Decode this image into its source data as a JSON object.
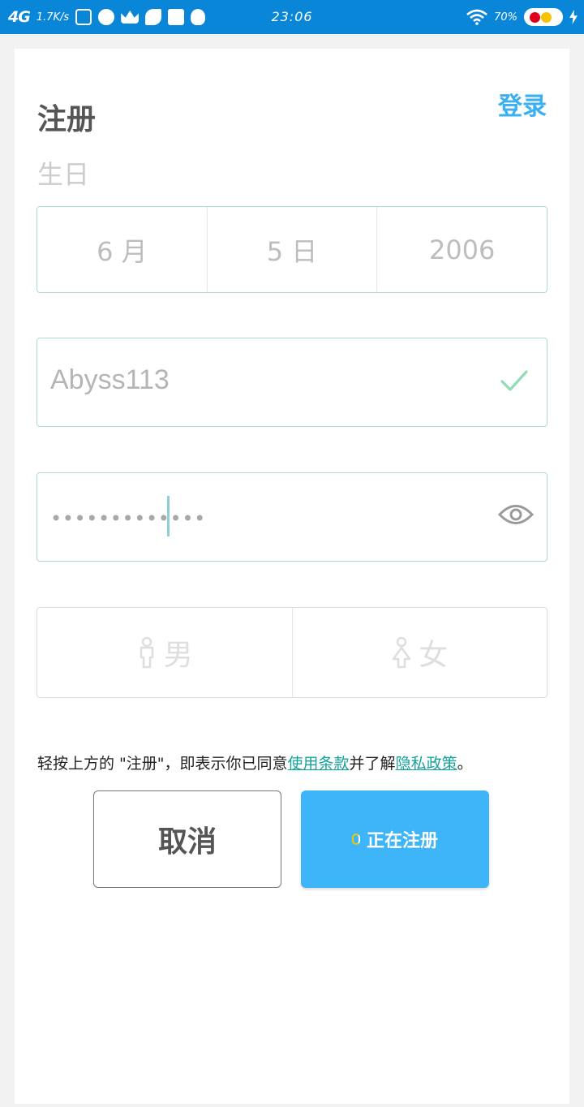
{
  "status_bar": {
    "network": "4G",
    "speed": "1.7K/s",
    "time": "23:06",
    "battery": "70%",
    "icons": [
      "s-icon",
      "play-icon",
      "crown-icon",
      "fan-icon",
      "mail-icon",
      "qq-icon"
    ]
  },
  "header": {
    "title": "注册",
    "login_link": "登录"
  },
  "birthday": {
    "label": "生日",
    "month": "6 月",
    "day": "5 日",
    "year": "2006"
  },
  "username": {
    "value": "Abyss113",
    "status_icon": "check-icon"
  },
  "password": {
    "masked_value": "•••••••••••••",
    "toggle_icon": "eye-icon"
  },
  "gender": {
    "male": "男",
    "female": "女"
  },
  "terms": {
    "prefix": "轻按上方的 \"注册\"，即表示你已同意",
    "terms_link": "使用条款",
    "middle": "并了解",
    "privacy_link": "隐私政策",
    "suffix": "。"
  },
  "buttons": {
    "cancel": "取消",
    "register": "正在注册"
  },
  "colors": {
    "status_bar": "#0a86d8",
    "accent": "#3ab0f2",
    "register_button": "#3db5f8",
    "field_border": "#a9dfc5",
    "link": "#14a39a"
  }
}
